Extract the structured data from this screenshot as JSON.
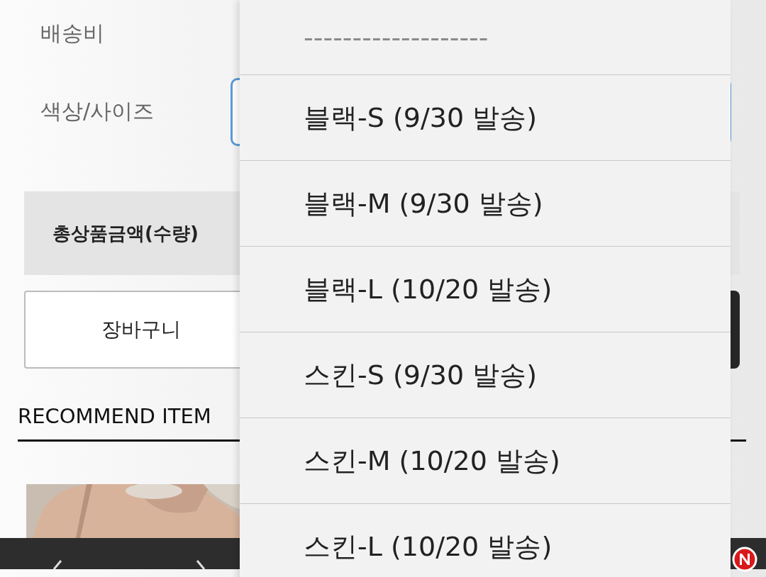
{
  "page": {
    "fields": [
      {
        "label": "배송비"
      },
      {
        "label": "색상/사이즈"
      }
    ],
    "total_label": "총상품금액(수량)",
    "cart_button": "장바구니",
    "section_title": "RECOMMEND ITEM"
  },
  "dropdown": {
    "options": [
      {
        "label": "-------------------",
        "disabled": true
      },
      {
        "label": "블랙-S (9/30 발송)",
        "disabled": false
      },
      {
        "label": "블랙-M (9/30 발송)",
        "disabled": false
      },
      {
        "label": "블랙-L (10/20 발송)",
        "disabled": false
      },
      {
        "label": "스킨-S (9/30 발송)",
        "disabled": false
      },
      {
        "label": "스킨-M (10/20 발송)",
        "disabled": false
      },
      {
        "label": "스킨-L (10/20 발송)",
        "disabled": false
      }
    ]
  }
}
